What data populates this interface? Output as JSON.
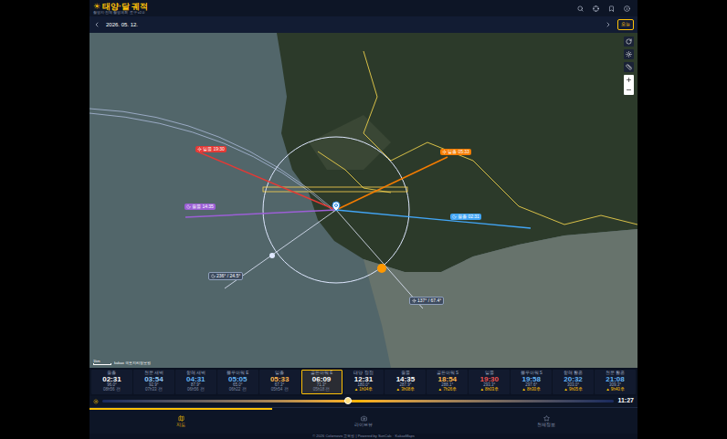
{
  "header": {
    "logo": "☀",
    "title": "태양·달 궤적",
    "subtitle": "촬영지·천체 촬영계획 도구 v2.0"
  },
  "date_bar": {
    "date": "2026. 05. 12.",
    "today_button": "오늘"
  },
  "map": {
    "labels": [
      {
        "body": "sun",
        "text": "일몰 19:30",
        "color": "#e53935"
      },
      {
        "body": "sun",
        "text": "일출 05:33",
        "color": "#f57c00"
      },
      {
        "body": "moon",
        "text": "월출 02:31",
        "color": "#42a5f5"
      },
      {
        "body": "moon",
        "text": "월몰 14:35",
        "color": "#9c5fd6"
      }
    ],
    "markers": [
      {
        "body": "moon",
        "text": "236° / 24.5°"
      },
      {
        "body": "sun",
        "text": "137° / 67.4°"
      }
    ],
    "scale": "1km",
    "attribution": "kakao 국토지리정보원"
  },
  "timeline": [
    {
      "label": "월출",
      "time": "02:31",
      "az": "96.0°",
      "rel": "08h56 전",
      "future": false,
      "selected": false,
      "color": "#ffffff"
    },
    {
      "label": "천문 새벽",
      "time": "03:54",
      "az": "92.9°",
      "rel": "07h33 전",
      "future": false,
      "selected": false,
      "color": "#90caf9"
    },
    {
      "label": "항해 새벽",
      "time": "04:31",
      "az": "87.9°",
      "rel": "06h56 전",
      "future": false,
      "selected": false,
      "color": "#64b5f6"
    },
    {
      "label": "블루아워 E",
      "time": "05:05",
      "az": "65.0°",
      "rel": "06h22 전",
      "future": false,
      "selected": false,
      "color": "#64b5f6"
    },
    {
      "label": "일출",
      "time": "05:33",
      "az": "67.3°",
      "rel": "05h54 전",
      "future": false,
      "selected": false,
      "color": "#ffb74d"
    },
    {
      "label": "골든아워 E",
      "time": "06:09",
      "az": "71.3°",
      "rel": "05h18 전",
      "future": false,
      "selected": true,
      "color": "#ffffff"
    },
    {
      "label": "태양 정점",
      "time": "12:31",
      "az": "180.0°",
      "rel": "▲ 1h04후",
      "future": true,
      "selected": false,
      "color": "#ffffff"
    },
    {
      "label": "월몰",
      "time": "14:35",
      "az": "287.9°",
      "rel": "▲ 3h08후",
      "future": true,
      "selected": false,
      "color": "#ffffff"
    },
    {
      "label": "골든아워 S",
      "time": "18:54",
      "az": "288.1°",
      "rel": "▲ 7h26후",
      "future": true,
      "selected": false,
      "color": "#ffb74d"
    },
    {
      "label": "일몰",
      "time": "19:30",
      "az": "293.3°",
      "rel": "▲ 8h03후",
      "future": true,
      "selected": false,
      "color": "#ef5350"
    },
    {
      "label": "블루아워 S",
      "time": "19:58",
      "az": "297.6°",
      "rel": "▲ 8h30후",
      "future": true,
      "selected": false,
      "color": "#64b5f6"
    },
    {
      "label": "항해 황혼",
      "time": "20:32",
      "az": "303.0°",
      "rel": "▲ 9h05후",
      "future": true,
      "selected": false,
      "color": "#64b5f6"
    },
    {
      "label": "천문 황혼",
      "time": "21:08",
      "az": "309.3°",
      "rel": "▲ 9h40후",
      "future": true,
      "selected": false,
      "color": "#64b5f6"
    }
  ],
  "slider": {
    "level": 0.48,
    "time": "11:27"
  },
  "nav": [
    {
      "label": "지도",
      "selected": true
    },
    {
      "label": "라이브뷰",
      "selected": false
    },
    {
      "label": "천체정보",
      "selected": false
    }
  ],
  "footer": "© 2026 Colornovis 교육원 | Powered by SunCalc · KakaoMaps"
}
